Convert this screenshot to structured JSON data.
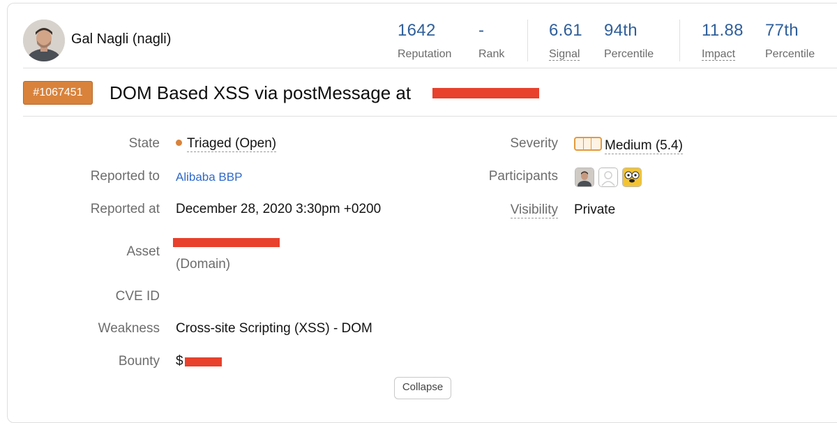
{
  "user": {
    "name": "Gal Nagli (nagli)"
  },
  "stats": [
    {
      "value": "1642",
      "label": "Reputation"
    },
    {
      "value": "-",
      "label": "Rank"
    },
    {
      "value": "6.61",
      "label": "Signal"
    },
    {
      "value": "94th",
      "label": "Percentile"
    },
    {
      "value": "11.88",
      "label": "Impact"
    },
    {
      "value": "77th",
      "label": "Percentile"
    }
  ],
  "report": {
    "id": "#1067451",
    "title": "DOM Based XSS via postMessage at"
  },
  "details": {
    "state": {
      "label": "State",
      "value": "Triaged (Open)"
    },
    "reported_to": {
      "label": "Reported to",
      "value": "Alibaba BBP"
    },
    "reported_at": {
      "label": "Reported at",
      "value": "December 28, 2020 3:30pm +0200"
    },
    "asset": {
      "label": "Asset",
      "type": "(Domain)"
    },
    "cve": {
      "label": "CVE ID",
      "value": ""
    },
    "weakness": {
      "label": "Weakness",
      "value": "Cross-site Scripting (XSS) - DOM"
    },
    "bounty": {
      "label": "Bounty",
      "value": "$"
    }
  },
  "right_details": {
    "severity": {
      "label": "Severity",
      "value": "Medium (5.4)"
    },
    "participants": {
      "label": "Participants"
    },
    "visibility": {
      "label": "Visibility",
      "value": "Private"
    }
  },
  "colors": {
    "accent_blue": "#2f5f9a",
    "badge_orange": "#d9823b",
    "redaction": "#e8412c"
  },
  "collapse_button": {
    "label": "Collapse"
  }
}
